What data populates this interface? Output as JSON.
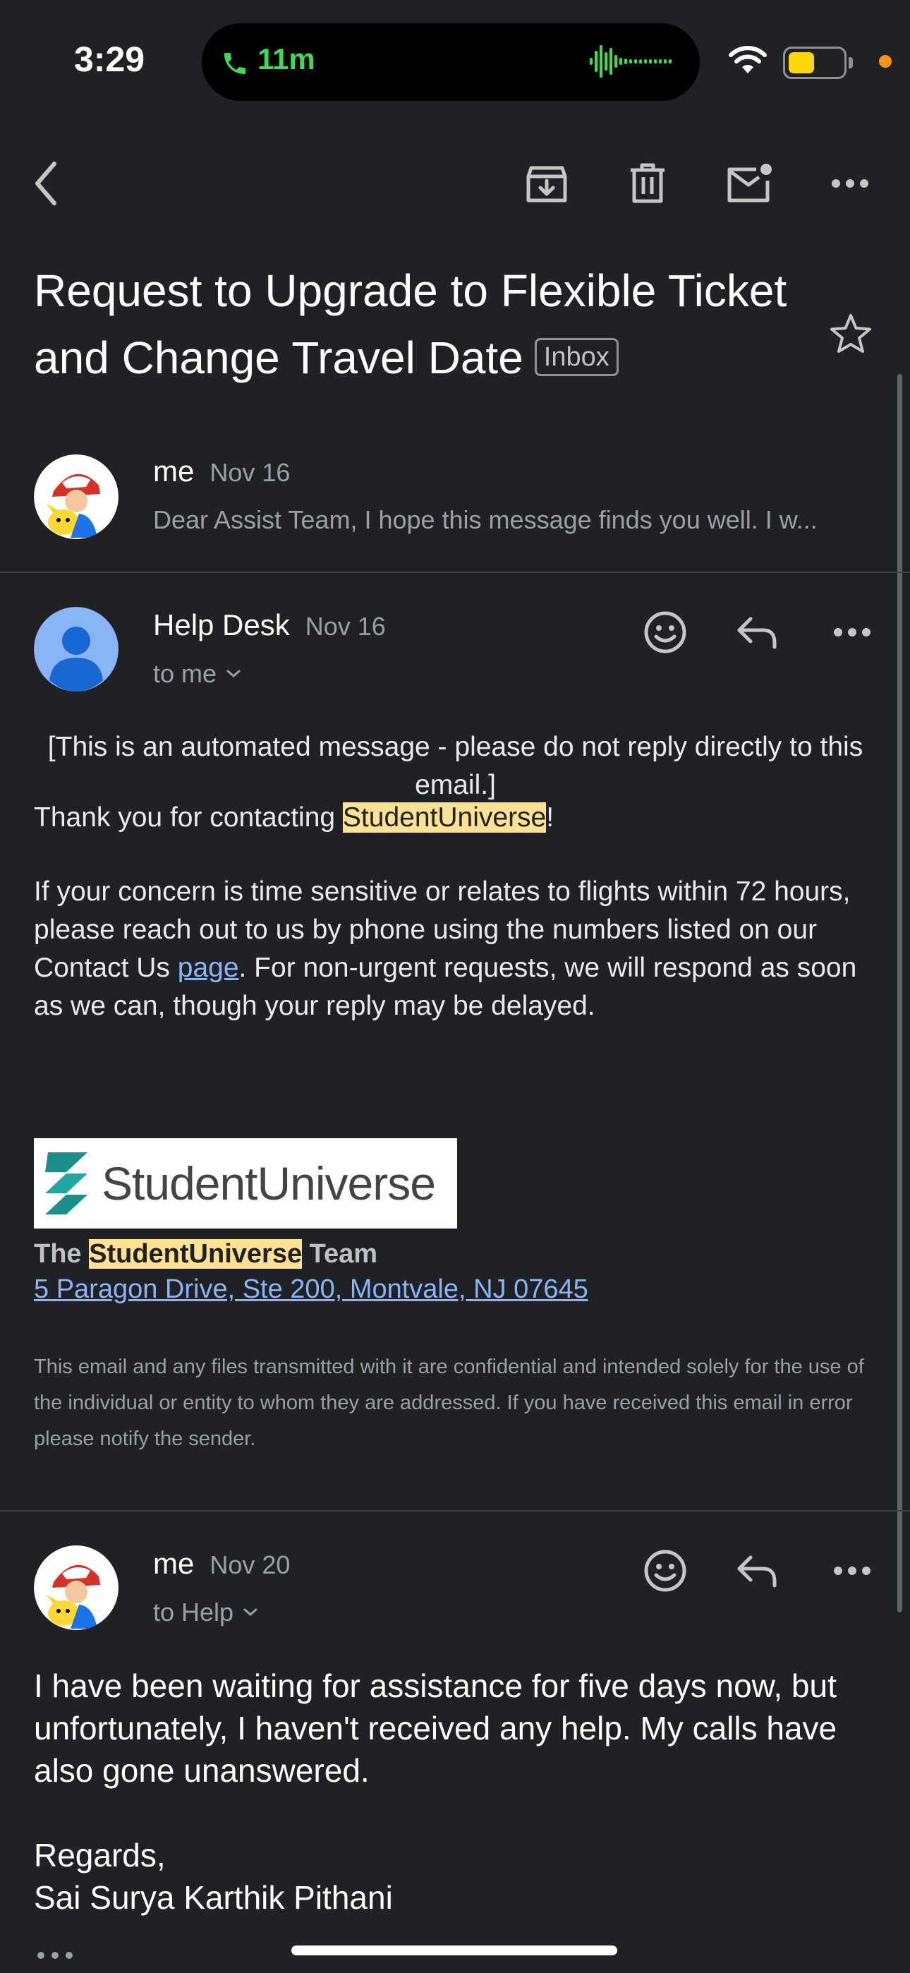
{
  "status_bar": {
    "time": "3:29",
    "call_duration": "11m"
  },
  "email": {
    "subject": "Request to Upgrade to Flexible Ticket and Change Travel Date",
    "label": "Inbox"
  },
  "messages": [
    {
      "sender": "me",
      "date": "Nov 16",
      "snippet": "Dear Assist Team, I hope this message finds you well. I w..."
    },
    {
      "sender": "Help Desk",
      "date": "Nov 16",
      "to": "to me",
      "automated_notice": "[This is an automated message - please do not reply directly to this email.]",
      "thanks_prefix": "Thank you for contacting ",
      "brand": "StudentUniverse",
      "thanks_suffix": "!",
      "para_before_link": "If your concern is time sensitive or relates to flights within 72 hours, please reach out to us by phone using the numbers listed on our Contact Us ",
      "link_text": "page",
      "para_after_link": ". For non-urgent requests, we will respond as soon as we can, though your reply may be delayed.",
      "logo_text": "StudentUniverse",
      "signature_prefix": "The ",
      "signature_brand": "StudentUniverse",
      "signature_suffix": " Team",
      "address": "5 Paragon Drive, Ste 200, Montvale, NJ 07645",
      "disclaimer": "This email and any files transmitted with it are confidential and intended solely for the use of the individual or entity to whom they are addressed. If you have received this email in error please notify the sender."
    },
    {
      "sender": "me",
      "date": "Nov 20",
      "to": "to Help",
      "body": "I have been waiting for assistance for five days now, but unfortunately, I haven't received any help. My calls have also gone unanswered.",
      "closing": "Regards,",
      "name": "Sai Surya Karthik Pithani"
    }
  ],
  "icons": [
    "phone-icon",
    "waveform-icon",
    "wifi-icon",
    "battery-icon",
    "back-icon",
    "archive-icon",
    "delete-icon",
    "mark-unread-icon",
    "more-icon",
    "star-icon",
    "emoji-icon",
    "reply-icon",
    "avatar-icon"
  ],
  "colors": {
    "background": "#202124",
    "highlight": "#fde293",
    "link": "#8ab4f8",
    "call_green": "#3ddc55",
    "battery_yellow": "#ffd60a"
  }
}
